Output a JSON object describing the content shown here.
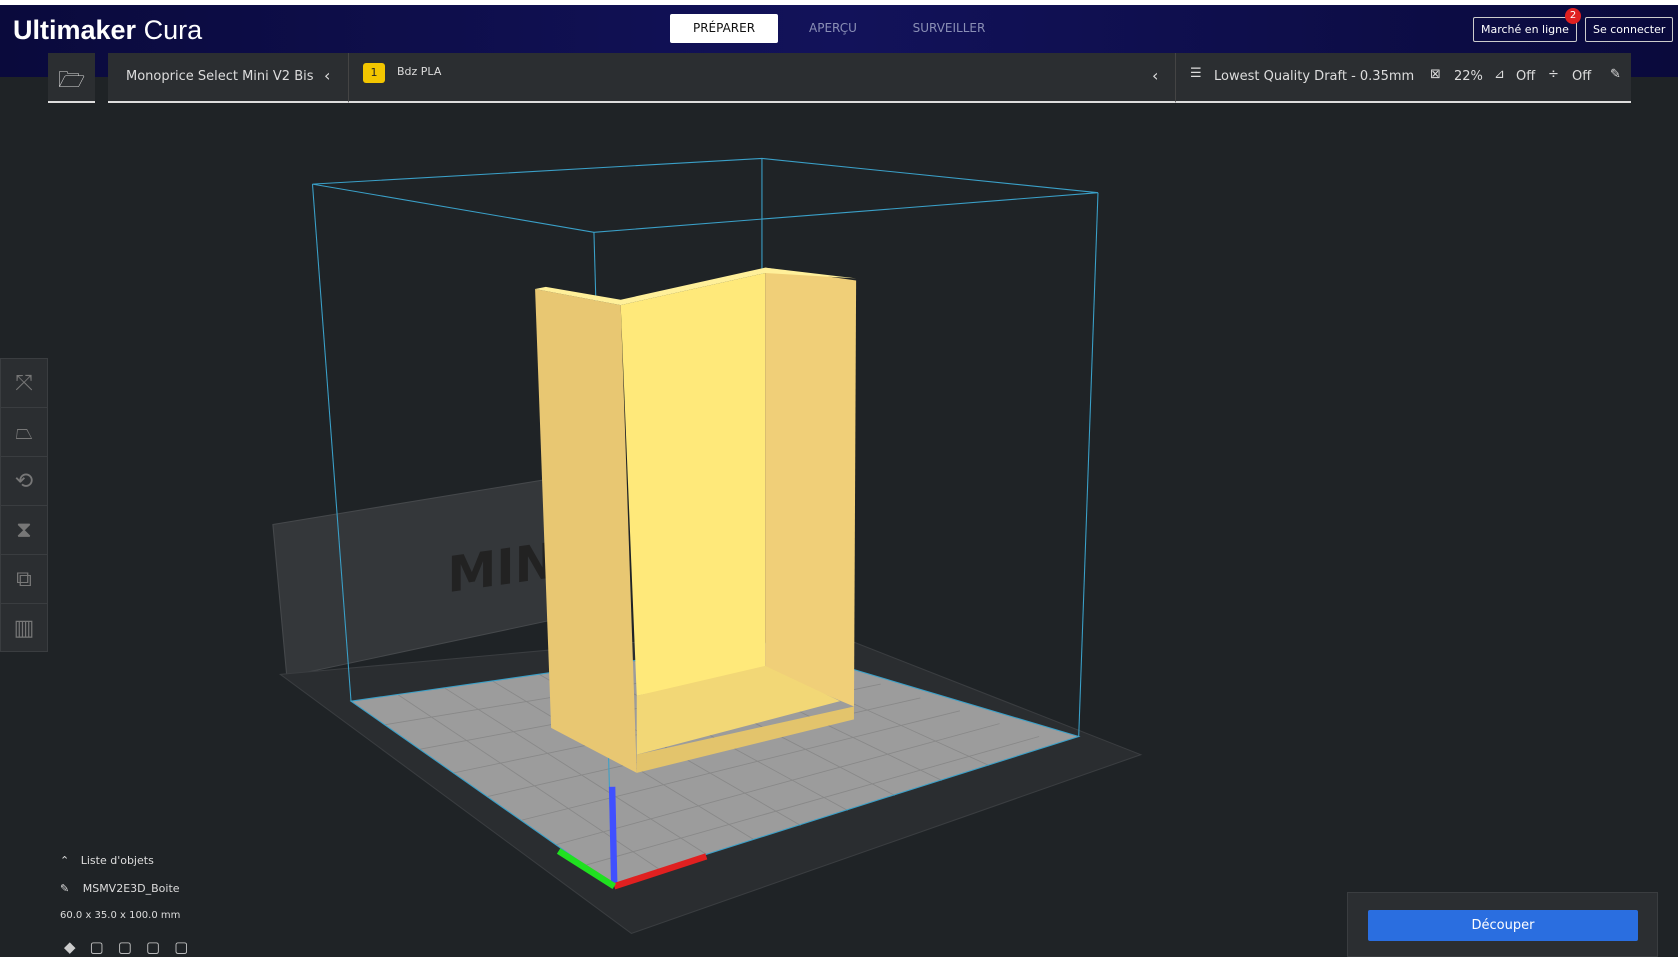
{
  "app": {
    "logo_bold": "Ultimaker",
    "logo_light": "Cura"
  },
  "tabs": [
    {
      "label": "PRÉPARER",
      "active": true
    },
    {
      "label": "APERÇU"
    },
    {
      "label": "SURVEILLER"
    }
  ],
  "header": {
    "marketplace": "Marché en ligne",
    "marketplace_badge": "2",
    "login": "Se connecter"
  },
  "toolbar": {
    "printer": "Monoprice Select Mini V2 Bis",
    "extruder_number": "1",
    "material": "Bdz PLA",
    "profile": "Lowest Quality Draft - 0.35mm",
    "infill": "22%",
    "support": "Off",
    "adhesion": "Off"
  },
  "scene": {
    "bed_logo": "MINI"
  },
  "object_list": {
    "title": "Liste d'objets",
    "object_name": "MSMV2E3D_Boite",
    "dimensions": "60.0 x 35.0 x 100.0 mm"
  },
  "slice": {
    "button": "Découper"
  },
  "colors": {
    "accent": "#2a6ee0",
    "model": "#ffe97a",
    "header": "#0a0a3c"
  }
}
